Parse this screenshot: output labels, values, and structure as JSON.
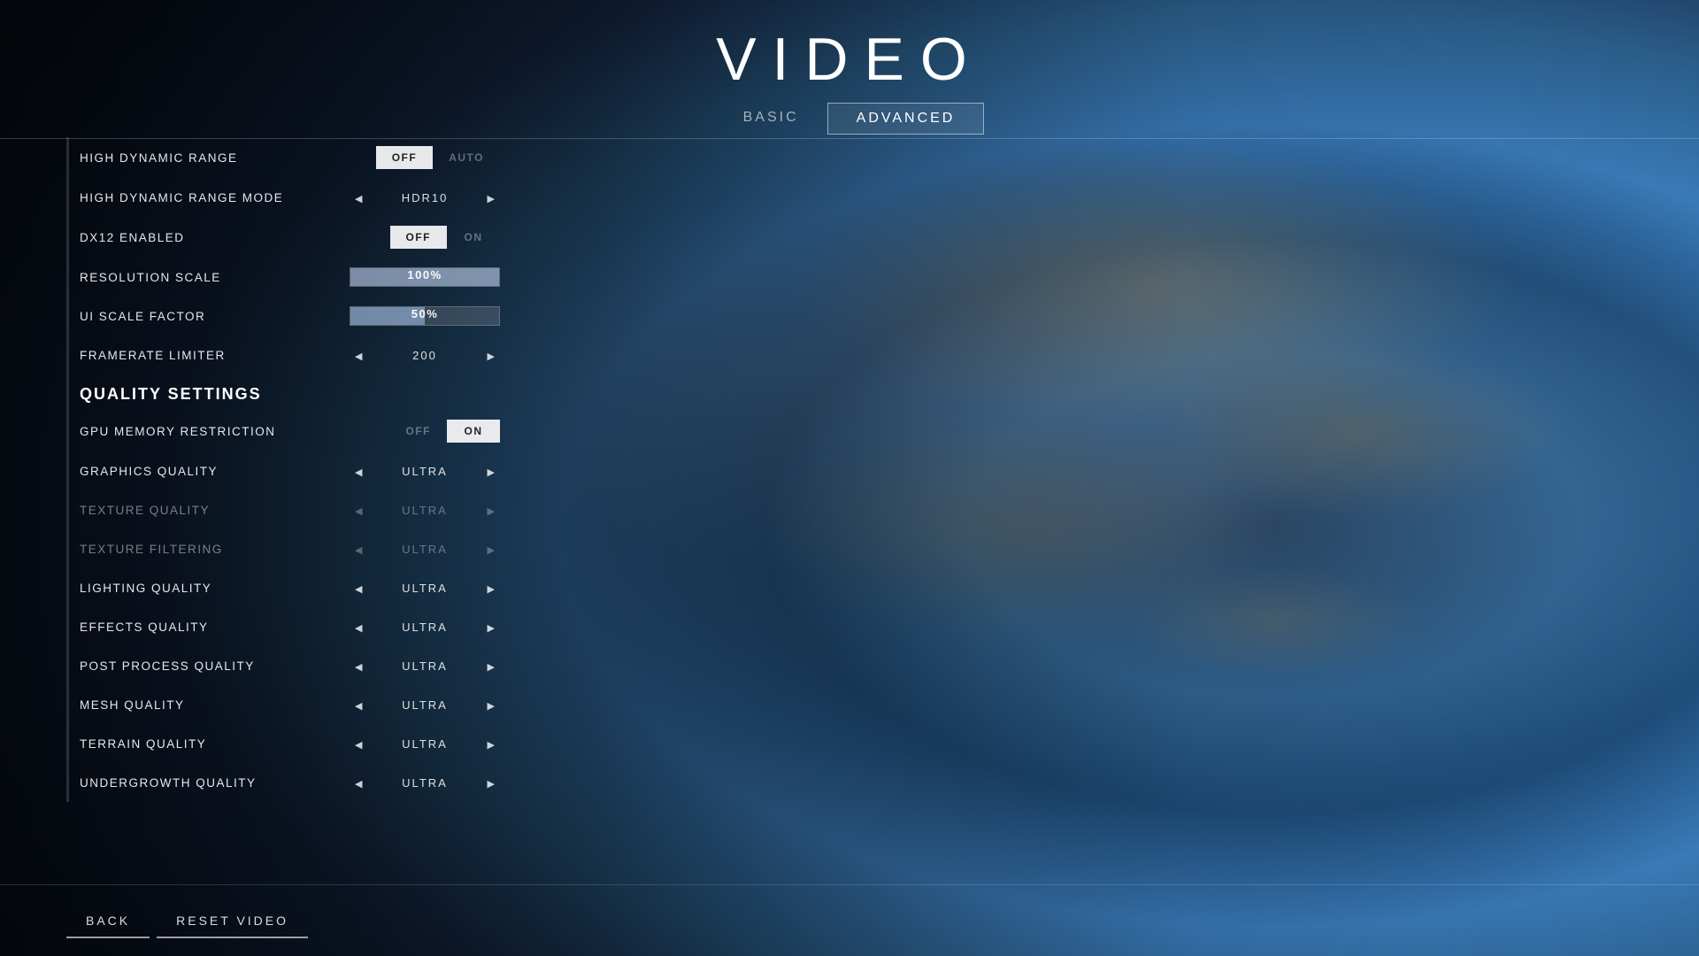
{
  "page": {
    "title": "VIDEO",
    "background": "earth"
  },
  "tabs": [
    {
      "id": "basic",
      "label": "BASIC",
      "active": false
    },
    {
      "id": "advanced",
      "label": "ADVANCED",
      "active": true
    }
  ],
  "settings": {
    "sections": [
      {
        "type": "setting",
        "label": "HIGH DYNAMIC RANGE",
        "control": "toggle",
        "value": "OFF",
        "options": [
          "OFF",
          "AUTO"
        ],
        "active": "OFF"
      },
      {
        "type": "setting",
        "label": "HIGH DYNAMIC RANGE MODE",
        "control": "arrow-select",
        "value": "HDR10"
      },
      {
        "type": "setting",
        "label": "DX12 ENABLED",
        "control": "toggle",
        "value": "OFF",
        "options": [
          "OFF",
          "ON"
        ],
        "active": "OFF"
      },
      {
        "type": "setting",
        "label": "RESOLUTION SCALE",
        "control": "slider",
        "value": "100%",
        "percent": 100
      },
      {
        "type": "setting",
        "label": "UI SCALE FACTOR",
        "control": "slider",
        "value": "50%",
        "percent": 50
      },
      {
        "type": "setting",
        "label": "FRAMERATE LIMITER",
        "control": "arrow-select",
        "value": "200"
      },
      {
        "type": "section-header",
        "label": "QUALITY SETTINGS"
      },
      {
        "type": "setting",
        "label": "GPU MEMORY RESTRICTION",
        "control": "toggle",
        "value": "ON",
        "options": [
          "OFF",
          "ON"
        ],
        "active": "ON"
      },
      {
        "type": "setting",
        "label": "GRAPHICS QUALITY",
        "control": "arrow-select",
        "value": "ULTRA",
        "dimmed": false
      },
      {
        "type": "setting",
        "label": "TEXTURE QUALITY",
        "control": "arrow-select",
        "value": "ULTRA",
        "dimmed": true
      },
      {
        "type": "setting",
        "label": "TEXTURE FILTERING",
        "control": "arrow-select",
        "value": "ULTRA",
        "dimmed": true
      },
      {
        "type": "setting",
        "label": "LIGHTING QUALITY",
        "control": "arrow-select",
        "value": "ULTRA",
        "dimmed": false
      },
      {
        "type": "setting",
        "label": "EFFECTS QUALITY",
        "control": "arrow-select",
        "value": "ULTRA",
        "dimmed": false
      },
      {
        "type": "setting",
        "label": "POST PROCESS QUALITY",
        "control": "arrow-select",
        "value": "ULTRA",
        "dimmed": false
      },
      {
        "type": "setting",
        "label": "MESH QUALITY",
        "control": "arrow-select",
        "value": "ULTRA",
        "dimmed": false
      },
      {
        "type": "setting",
        "label": "TERRAIN QUALITY",
        "control": "arrow-select",
        "value": "ULTRA",
        "dimmed": false
      },
      {
        "type": "setting",
        "label": "UNDERGROWTH QUALITY",
        "control": "arrow-select",
        "value": "ULTRA",
        "dimmed": false
      }
    ]
  },
  "buttons": {
    "back": "BACK",
    "reset": "RESET VIDEO"
  }
}
